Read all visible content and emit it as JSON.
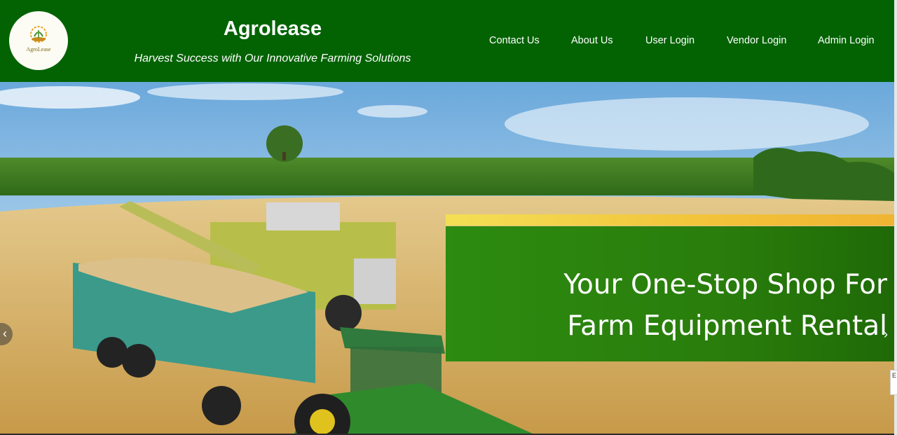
{
  "brand": {
    "logo_text": "AgroLease",
    "title": "Agrolease",
    "tagline": "Harvest Success with Our Innovative Farming Solutions"
  },
  "nav": {
    "items": [
      {
        "label": "Contact Us"
      },
      {
        "label": "About Us"
      },
      {
        "label": "User Login"
      },
      {
        "label": "Vendor Login"
      },
      {
        "label": "Admin Login"
      }
    ]
  },
  "hero": {
    "promo_line_1": "Your One-Stop Shop For",
    "promo_line_2": "Farm Equipment Rental",
    "prev_label": "‹",
    "next_label": "›"
  },
  "side_widget": {
    "label": "E"
  },
  "colors": {
    "header_bg": "#036303",
    "promo_green": "#2a7e0c",
    "promo_stripe": "#f2c23a"
  }
}
